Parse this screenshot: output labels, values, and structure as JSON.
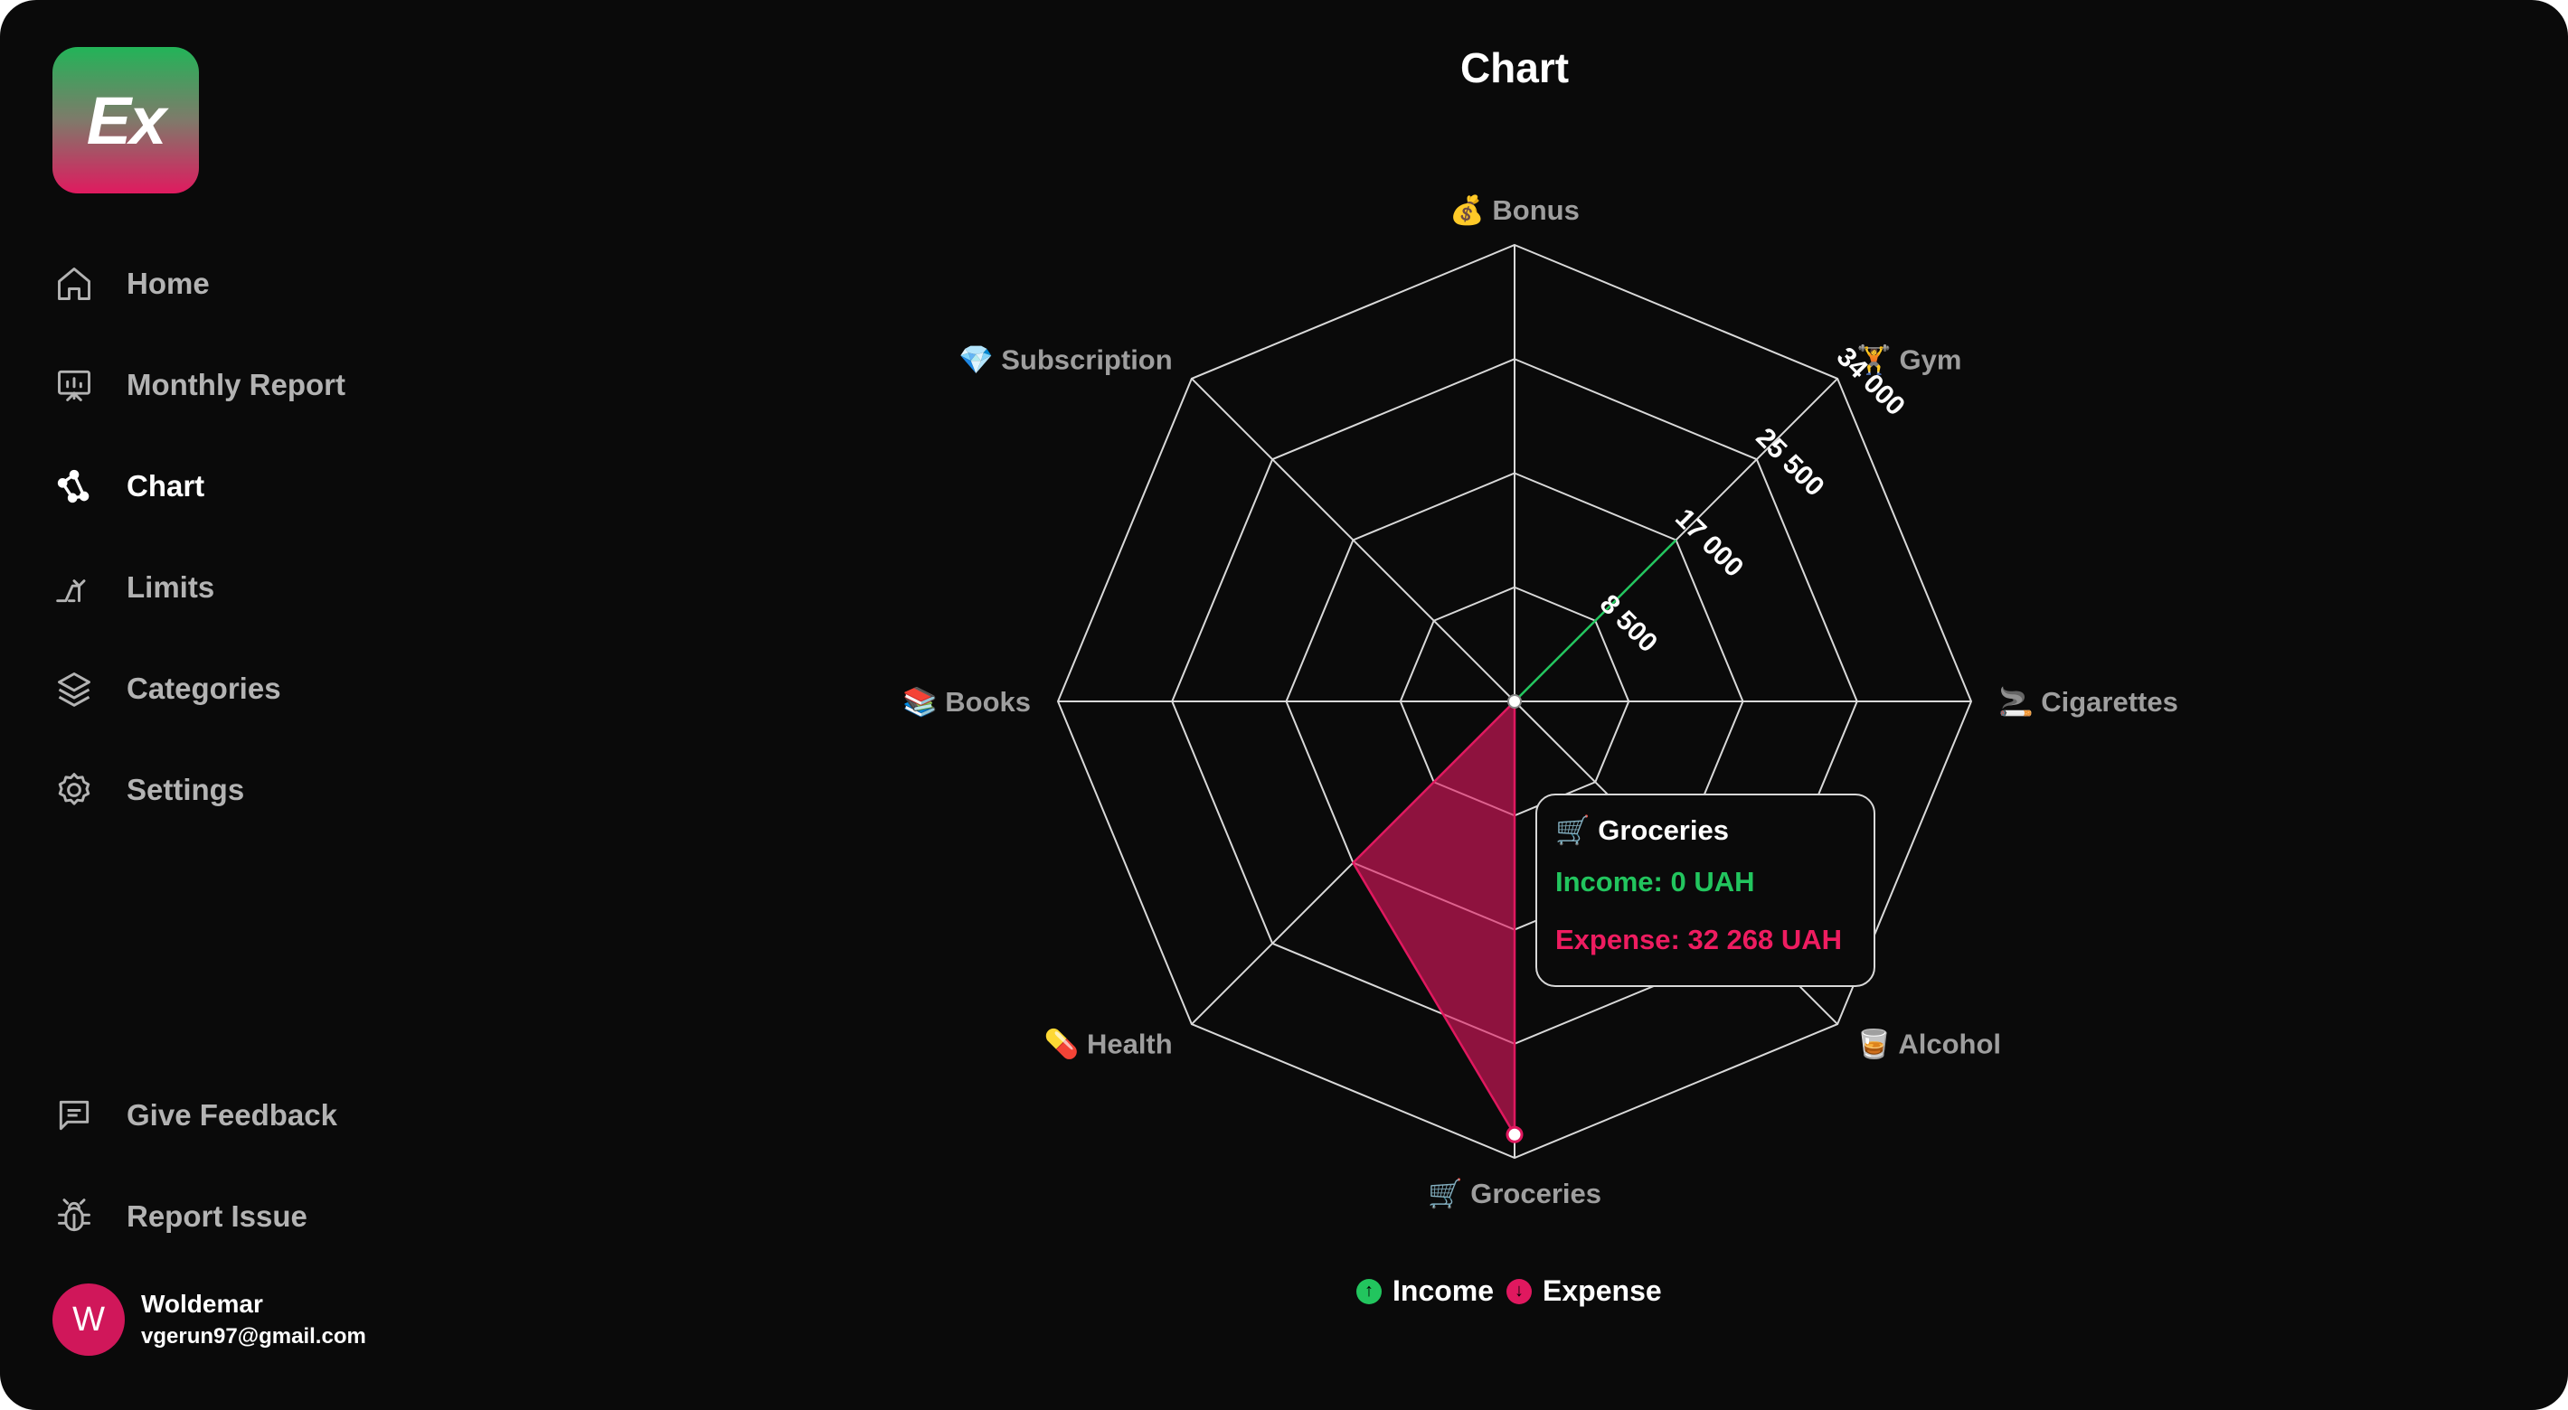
{
  "app": {
    "logo_text": "Ex"
  },
  "sidebar": {
    "items": [
      {
        "label": "Home",
        "icon": "home-icon"
      },
      {
        "label": "Monthly Report",
        "icon": "presentation-chart-icon"
      },
      {
        "label": "Chart",
        "icon": "radar-chart-icon",
        "active": true
      },
      {
        "label": "Limits",
        "icon": "trend-up-icon"
      },
      {
        "label": "Categories",
        "icon": "layers-icon"
      },
      {
        "label": "Settings",
        "icon": "gear-icon"
      }
    ],
    "bottom_items": [
      {
        "label": "Give Feedback",
        "icon": "message-square-icon"
      },
      {
        "label": "Report Issue",
        "icon": "bug-icon"
      }
    ],
    "user": {
      "initial": "W",
      "name": "Woldemar",
      "email": "vgerun97@gmail.com"
    }
  },
  "page": {
    "title": "Chart"
  },
  "colors": {
    "income": "#22c55e",
    "expense": "#e0185f",
    "avatar": "#d0175a"
  },
  "chart_data": {
    "type": "radar",
    "categories": [
      "💰 Bonus",
      "🏋️ Gym",
      "🚬 Cigarettes",
      "🥃 Alcohol",
      "🛒 Groceries",
      "💊 Health",
      "📚 Books",
      "💎 Subscription"
    ],
    "radial_ticks": [
      "8 500",
      "17 000",
      "25 500",
      "34 000"
    ],
    "r_max": 34000,
    "series": [
      {
        "name": "Income",
        "values": [
          0,
          17000,
          0,
          0,
          0,
          0,
          0,
          0
        ]
      },
      {
        "name": "Expense",
        "values": [
          0,
          0,
          0,
          0,
          32268,
          17000,
          0,
          0
        ]
      }
    ],
    "legend": "bottom"
  },
  "tooltip": {
    "title": "🛒 Groceries",
    "income": "Income: 0 UAH",
    "expense": "Expense: 32 268 UAH"
  },
  "legend": {
    "income_label": "Income",
    "expense_label": "Expense",
    "income_icon": "arrow-up-icon",
    "expense_icon": "arrow-down-icon"
  }
}
